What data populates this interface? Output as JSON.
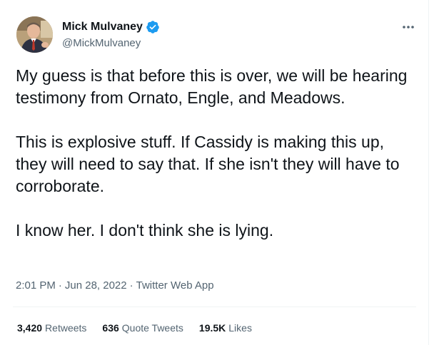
{
  "author": {
    "name": "Mick Mulvaney",
    "handle": "@MickMulvaney",
    "verified_icon": "verified-badge-icon"
  },
  "more_icon": "more-dots-icon",
  "tweet": {
    "paragraphs": [
      "My guess is that before this is over, we will be hearing testimony from Ornato, Engle, and Meadows.",
      "This is explosive stuff.  If Cassidy is making this up, they will need to say that.  If she isn't they will have to corroborate.",
      "I know her. I don't think she is lying."
    ]
  },
  "meta": {
    "time": "2:01 PM",
    "separator": "·",
    "date": "Jun 28, 2022",
    "source": "Twitter Web App"
  },
  "stats": {
    "retweets_count": "3,420",
    "retweets_label": "Retweets",
    "quotes_count": "636",
    "quotes_label": "Quote Tweets",
    "likes_count": "19.5K",
    "likes_label": "Likes"
  },
  "colors": {
    "text": "#0f1419",
    "secondary": "#536471",
    "verified": "#1d9bf0",
    "divider": "#eff3f4"
  }
}
